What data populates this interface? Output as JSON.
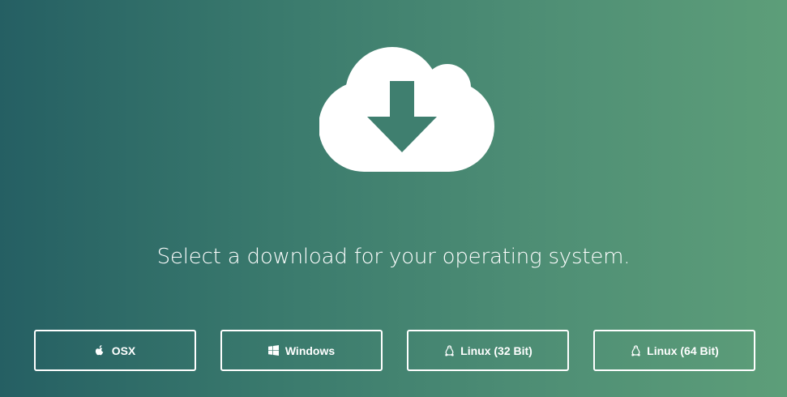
{
  "headline": "Select a download for your operating system.",
  "downloads": [
    {
      "label": "OSX",
      "icon": "apple-icon"
    },
    {
      "label": "Windows",
      "icon": "windows-icon"
    },
    {
      "label": "Linux (32 Bit)",
      "icon": "linux-icon"
    },
    {
      "label": "Linux (64 Bit)",
      "icon": "linux-icon"
    }
  ],
  "colors": {
    "gradient_start": "#255f63",
    "gradient_end": "#5d9e79",
    "foreground": "#ffffff"
  }
}
